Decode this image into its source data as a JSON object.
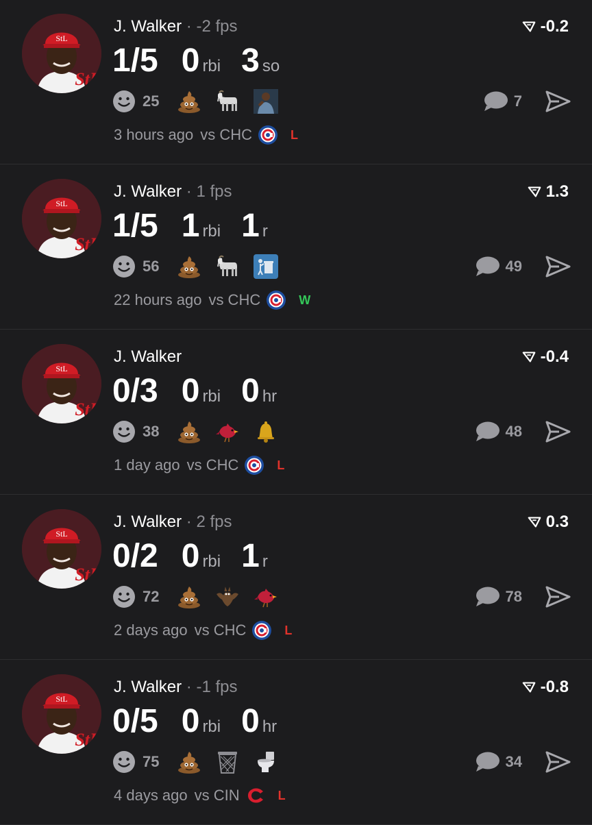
{
  "colors": {
    "background": "#1c1c1e",
    "muted": "#9b9ba0",
    "loss": "#e0322b",
    "win": "#34c759"
  },
  "posts": [
    {
      "player": "J. Walker",
      "fps": "· -2 fps",
      "score": "-0.2",
      "stats": [
        {
          "value": "1/5",
          "unit": ""
        },
        {
          "value": "0",
          "unit": "rbi"
        },
        {
          "value": "3",
          "unit": "so"
        }
      ],
      "smiley_count": "25",
      "emojis": [
        "poop-emoji",
        "goat-emoji",
        "player-emoji"
      ],
      "comments": "7",
      "time": "3 hours ago",
      "vs": "vs CHC",
      "opponent_logo": "cubs-logo",
      "result": "L",
      "result_color": "#e0322b"
    },
    {
      "player": "J. Walker",
      "fps": "· 1 fps",
      "score": "1.3",
      "stats": [
        {
          "value": "1/5",
          "unit": ""
        },
        {
          "value": "1",
          "unit": "rbi"
        },
        {
          "value": "1",
          "unit": "r"
        }
      ],
      "smiley_count": "56",
      "emojis": [
        "poop-emoji",
        "goat-emoji",
        "trash-emoji"
      ],
      "comments": "49",
      "time": "22 hours ago",
      "vs": "vs CHC",
      "opponent_logo": "cubs-logo",
      "result": "W",
      "result_color": "#34c759"
    },
    {
      "player": "J. Walker",
      "fps": "",
      "score": "-0.4",
      "stats": [
        {
          "value": "0/3",
          "unit": ""
        },
        {
          "value": "0",
          "unit": "rbi"
        },
        {
          "value": "0",
          "unit": "hr"
        }
      ],
      "smiley_count": "38",
      "emojis": [
        "poop-emoji",
        "cardinal-emoji",
        "bell-emoji"
      ],
      "comments": "48",
      "time": "1 day ago",
      "vs": "vs CHC",
      "opponent_logo": "cubs-logo",
      "result": "L",
      "result_color": "#e0322b"
    },
    {
      "player": "J. Walker",
      "fps": "· 2 fps",
      "score": "0.3",
      "stats": [
        {
          "value": "0/2",
          "unit": ""
        },
        {
          "value": "0",
          "unit": "rbi"
        },
        {
          "value": "1",
          "unit": "r"
        }
      ],
      "smiley_count": "72",
      "emojis": [
        "poop-emoji",
        "bat-emoji",
        "cardinal-emoji"
      ],
      "comments": "78",
      "time": "2 days ago",
      "vs": "vs CHC",
      "opponent_logo": "cubs-logo",
      "result": "L",
      "result_color": "#e0322b"
    },
    {
      "player": "J. Walker",
      "fps": "· -1 fps",
      "score": "-0.8",
      "stats": [
        {
          "value": "0/5",
          "unit": ""
        },
        {
          "value": "0",
          "unit": "rbi"
        },
        {
          "value": "0",
          "unit": "hr"
        }
      ],
      "smiley_count": "75",
      "emojis": [
        "poop-emoji",
        "trashcan-emoji",
        "toilet-emoji"
      ],
      "comments": "34",
      "time": "4 days ago",
      "vs": "vs CIN",
      "opponent_logo": "reds-logo",
      "result": "L",
      "result_color": "#e0322b"
    }
  ]
}
